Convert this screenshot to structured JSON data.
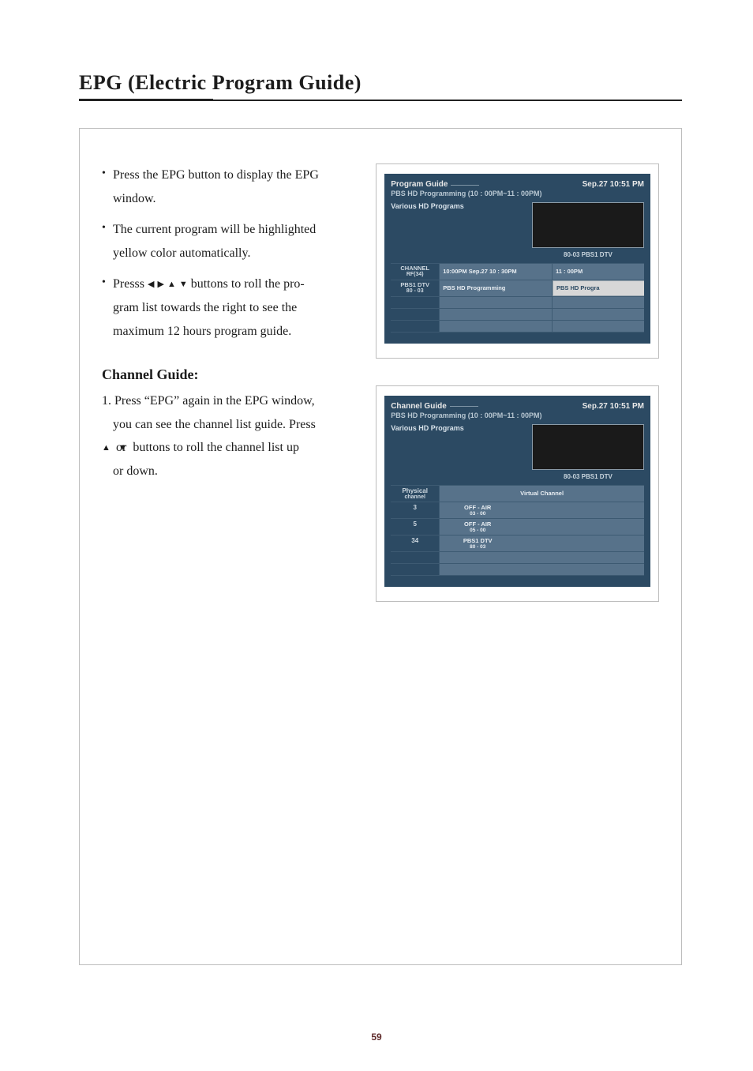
{
  "page": {
    "title": "EPG (Electric Program Guide)",
    "number": "59"
  },
  "bullets": {
    "b1a": "Press the EPG button to display the EPG",
    "b1b": "window.",
    "b2a": "The current program will be highlighted",
    "b2b": "yellow color automatically.",
    "b3a": "Presss ",
    "b3b": " buttons to roll the pro-",
    "b3c": "gram list towards the right to see the",
    "b3d": "maximum 12 hours program guide."
  },
  "channelGuide": {
    "heading": "Channel Guide:",
    "s1a": "1. Press “EPG” again in the EPG window,",
    "s1b": "you can see the channel list guide.  Press",
    "s1c_pre": "",
    "s1c_mid": " or ",
    "s1c_post": "  buttons to roll the channel list up",
    "s1d": "or down."
  },
  "shot1": {
    "title": "Program Guide",
    "datetime": "Sep.27  10:51  PM",
    "sub": "PBS HD Programming (10 : 00PM~11 : 00PM)",
    "desc": "Various HD Programs",
    "thumbCap": "80-03  PBS1 DTV",
    "row1": {
      "lab1": "CHANNEL",
      "lab2": "RF(34)",
      "c1": "10:00PM  Sep.27  10 : 30PM",
      "c2": "11 : 00PM"
    },
    "row2": {
      "lab1": "PBS1 DTV",
      "lab2": "80 - 03",
      "c1": "PBS HD Programming",
      "c2": "PBS HD Progra"
    }
  },
  "shot2": {
    "title": "Channel Guide",
    "datetime": "Sep.27  10:51  PM",
    "sub": "PBS HD Programming (10 : 00PM~11 : 00PM)",
    "desc": "Various HD Programs",
    "thumbCap": "80-03  PBS1 DTV",
    "hdrL1": "Physical",
    "hdrL2": "channel",
    "hdrR": "Virtual Channel",
    "r1": {
      "n": "3",
      "v1": "OFF - AIR",
      "v2": "03 - 00"
    },
    "r2": {
      "n": "5",
      "v1": "OFF - AIR",
      "v2": "05 - 00"
    },
    "r3": {
      "n": "34",
      "v1": "PBS1 DTV",
      "v2": "80 - 03"
    }
  }
}
